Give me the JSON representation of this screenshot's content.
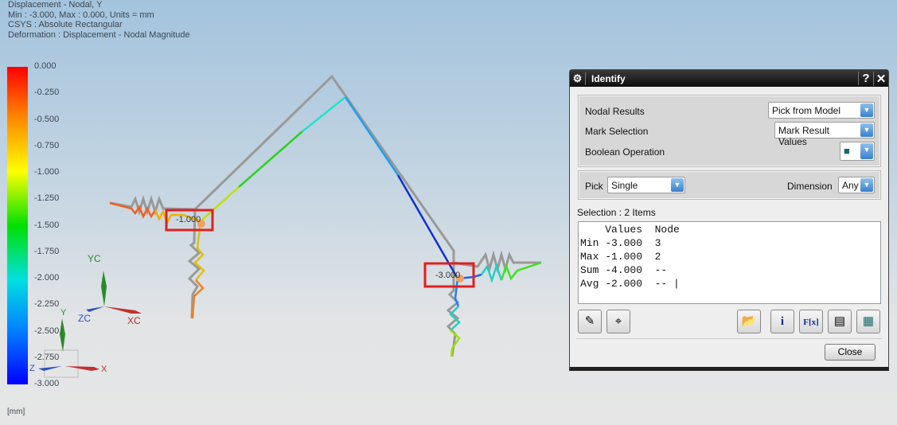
{
  "viewport": {
    "info": [
      "Displacement - Nodal, Y",
      "Min : -3.000, Max : 0.000, Units = mm",
      "CSYS : Absolute Rectangular",
      "Deformation : Displacement - Nodal Magnitude"
    ],
    "legend_ticks": [
      "0.000",
      "-0.250",
      "-0.500",
      "-0.750",
      "-1.000",
      "-1.250",
      "-1.500",
      "-1.750",
      "-2.000",
      "-2.250",
      "-2.500",
      "-2.750",
      "-3.000"
    ],
    "units": "[mm]",
    "markers": [
      "-1.000",
      "-3.000"
    ],
    "triad": {
      "y": "YC",
      "x": "XC",
      "z": "ZC"
    },
    "triad_small": {
      "y": "Y",
      "x": "X",
      "z": "Z"
    }
  },
  "dialog": {
    "title": "Identify",
    "help": "?",
    "close_x": "✕",
    "nodal_results_label": "Nodal Results",
    "nodal_results_value": "Pick from Model",
    "mark_selection_label": "Mark Selection",
    "mark_selection_value": "Mark Result Values",
    "boolean_label": "Boolean Operation",
    "pick_label": "Pick",
    "pick_value": "Single",
    "dimension_label": "Dimension",
    "dimension_value": "Any",
    "selection_label": "Selection : 2 Items",
    "results_text": "    Values  Node\nMin -3.000  3\nMax -1.000  2\nSum -4.000  --\nAvg -2.000  -- |",
    "fx": "F[x]",
    "info_icon": "i",
    "close_label": "Close"
  }
}
